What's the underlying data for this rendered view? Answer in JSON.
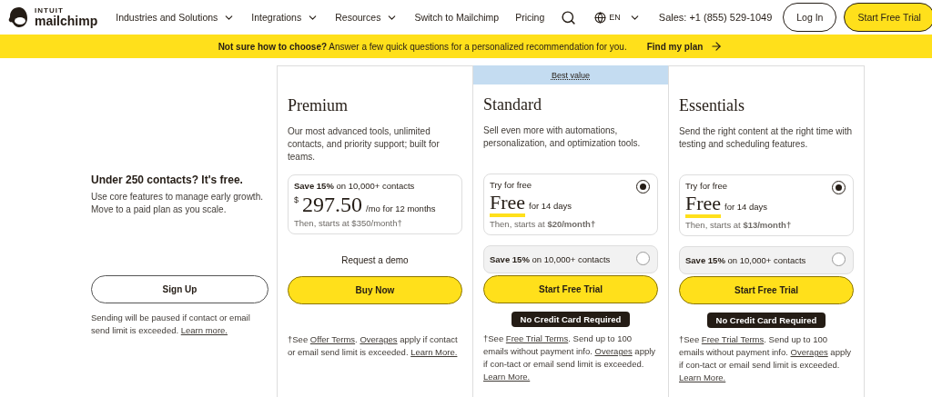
{
  "header": {
    "logo": {
      "top": "INTUIT",
      "bottom": "mailchimp"
    },
    "nav": [
      {
        "label": "Industries and Solutions",
        "dropdown": true
      },
      {
        "label": "Integrations",
        "dropdown": true
      },
      {
        "label": "Resources",
        "dropdown": true
      },
      {
        "label": "Switch to Mailchimp",
        "dropdown": false
      },
      {
        "label": "Pricing",
        "dropdown": false
      }
    ],
    "language": "EN",
    "sales": "Sales: +1 (855) 529-1049",
    "login": "Log In",
    "cta": "Start Free Trial"
  },
  "banner": {
    "text": "**Not sure how to choose?** Answer a few quick questions for a personalized recommendation for you.",
    "link": "Find my plan"
  },
  "free_plan": {
    "title": "Under 250 contacts? It's free.",
    "description": "Use core features to manage early growth. Move to a paid plan as you scale.",
    "button": "Sign Up",
    "note": [
      {
        "text": "Sending will be paused if contact or email send limit is exceeded. ",
        "link": false
      },
      {
        "text": "Learn more.",
        "link": true
      }
    ]
  },
  "plans": [
    {
      "name": "Premium",
      "description": "Our most advanced tools, unlimited contacts, and priority support; built for teams.",
      "options": [
        {
          "kind": "price",
          "label": "**Save 15%** on 10,000+ contacts",
          "currency": "$",
          "amount": "297.50",
          "period": "/mo for 12 months",
          "then": "Then, starts at $350/month†"
        }
      ],
      "secondary_link": "Request a demo",
      "button": "Buy Now",
      "footnote": [
        {
          "text": "†See ",
          "link": false
        },
        {
          "text": "Offer Terms",
          "link": true
        },
        {
          "text": ". ",
          "link": false
        },
        {
          "text": "Overages",
          "link": true
        },
        {
          "text": " apply if contact or email send limit is exceeded. ",
          "link": false
        },
        {
          "text": "Learn More.",
          "link": true
        }
      ]
    },
    {
      "name": "Standard",
      "ribbon": "Best value",
      "description": "Sell even more with automations, personalization, and optimization tools.",
      "options": [
        {
          "kind": "trial",
          "label": "Try for free",
          "amount": "Free",
          "period": "for 14 days",
          "then": "Then, starts at **$20/month†**",
          "selected": true
        },
        {
          "kind": "save",
          "label": "**Save 15%** on 10,000+ contacts",
          "selected": false
        }
      ],
      "button": "Start Free Trial",
      "badge": "No Credit Card Required",
      "footnote": [
        {
          "text": "†See ",
          "link": false
        },
        {
          "text": "Free Trial Terms",
          "link": true
        },
        {
          "text": ". Send up to 100 emails without payment info. ",
          "link": false
        },
        {
          "text": "Overages",
          "link": true
        },
        {
          "text": " apply if con-tact or email send limit is exceeded. ",
          "link": false
        },
        {
          "text": "Learn More.",
          "link": true
        }
      ]
    },
    {
      "name": "Essentials",
      "description": "Send the right content at the right time with testing and scheduling features.",
      "options": [
        {
          "kind": "trial",
          "label": "Try for free",
          "amount": "Free",
          "period": "for 14 days",
          "then": "Then, starts at **$13/month†**",
          "selected": true
        },
        {
          "kind": "save",
          "label": "**Save 15%** on 10,000+ contacts",
          "selected": false
        }
      ],
      "button": "Start Free Trial",
      "badge": "No Credit Card Required",
      "footnote": [
        {
          "text": "†See ",
          "link": false
        },
        {
          "text": "Free Trial Terms",
          "link": true
        },
        {
          "text": ". Send up to 100 emails without payment info. ",
          "link": false
        },
        {
          "text": "Overages",
          "link": true
        },
        {
          "text": " apply if con-tact or email send limit is exceeded. ",
          "link": false
        },
        {
          "text": "Learn More.",
          "link": true
        }
      ]
    }
  ]
}
